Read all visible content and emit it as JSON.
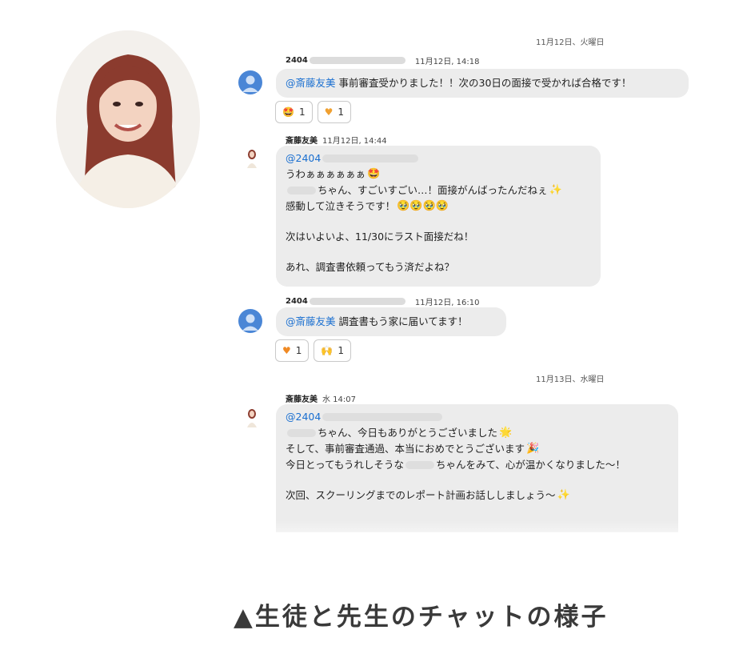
{
  "date_separators": [
    "11月12日、火曜日",
    "11月13日、水曜日"
  ],
  "messages": [
    {
      "sender": "2404",
      "time": "11月12日, 14:18",
      "mention": "@斎藤友美",
      "text": "事前審査受かりました！！次の30日の面接で受かれば合格です！",
      "reactions": [
        {
          "icon": "star-struck-emoji",
          "count": "1"
        },
        {
          "icon": "heart-hands-emoji",
          "count": "1"
        }
      ]
    },
    {
      "sender": "斎藤友美",
      "time": "11月12日, 14:44",
      "mention": "@2404",
      "lines": [
        "うわぁぁぁぁぁぁ",
        "ちゃん、すごいすごい…！面接がんばったんだねぇ",
        "感動して泣きそうです！",
        "次はいよいよ、11/30にラスト面接だね！",
        "あれ、調査書依頼ってもう済だよね？"
      ]
    },
    {
      "sender": "2404",
      "time": "11月12日, 16:10",
      "mention": "@斎藤友美",
      "text": "調査書もう家に届いてます！",
      "reactions": [
        {
          "icon": "orange-heart-emoji",
          "count": "1"
        },
        {
          "icon": "raising-hands-emoji",
          "count": "1"
        }
      ]
    },
    {
      "sender": "斎藤友美",
      "time": "水 14:07",
      "mention": "@2404",
      "lines": [
        "ちゃん、今日もありがとうございました",
        "そして、事前審査通過、本当におめでとうございます",
        "今日とってもうれしそうな",
        "ちゃんをみて、心が温かくなりました～！",
        "次回、スクーリングまでのレポート計画お話ししましょう～"
      ]
    }
  ],
  "caption": "▲生徒と先生のチャットの様子",
  "colors": {
    "mention": "#1a6fd0",
    "bubble": "#ececec",
    "avatar": "#4a86d6"
  }
}
